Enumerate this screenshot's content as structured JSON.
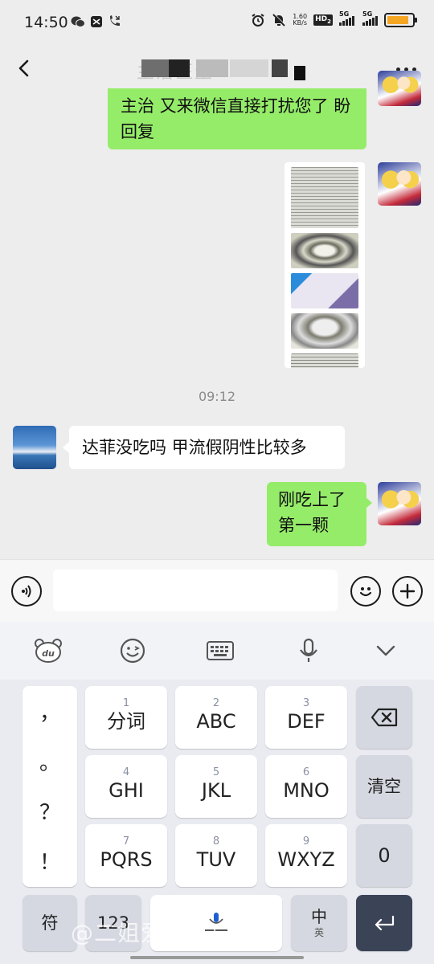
{
  "status_bar": {
    "time": "14:50",
    "net_speed": "1.60",
    "net_unit": "KB/s",
    "hd_badge": "HD",
    "hd_sub": "2",
    "sim1": "5G",
    "sim2": "5G",
    "battery_level": 0.85,
    "battery_color": "#f5a623",
    "icons": [
      "wechat-icon",
      "capcut-icon",
      "missed-call-icon",
      "alarm-icon",
      "mute-icon"
    ]
  },
  "header": {
    "title": "主治医生",
    "back_icon": "chevron-left-icon",
    "more_icon": "more-dots-icon"
  },
  "messages": {
    "m1": "主治   又来微信直接打扰您了 盼回复",
    "timestamp": "09:12",
    "m2": "达菲没吃吗 甲流假阴性比较多",
    "m3": "刚吃上了 第一颗"
  },
  "input_bar": {
    "voice_icon": "voice-icon",
    "emoji_icon": "emoji-icon",
    "plus_icon": "plus-icon"
  },
  "keyboard_toolbar": [
    "du-bear-icon",
    "smile-icon",
    "keyboard-icon",
    "mic-icon",
    "chevron-down-icon"
  ],
  "keyboard": {
    "symbols": [
      "，",
      "。",
      "？",
      "！"
    ],
    "keys": [
      {
        "num": "1",
        "label": "分词"
      },
      {
        "num": "2",
        "label": "ABC"
      },
      {
        "num": "3",
        "label": "DEF"
      },
      {
        "num": "4",
        "label": "GHI"
      },
      {
        "num": "5",
        "label": "JKL"
      },
      {
        "num": "6",
        "label": "MNO"
      },
      {
        "num": "7",
        "label": "PQRS"
      },
      {
        "num": "8",
        "label": "TUV"
      },
      {
        "num": "9",
        "label": "WXYZ"
      }
    ],
    "clear": "清空",
    "zero": "0",
    "fu": "符",
    "num123": "123",
    "zhong": "中",
    "ying": "英"
  },
  "watermark": "@二姐爱吃暖白小屋",
  "colors": {
    "mine_bubble": "#95ec69",
    "theirs_bubble": "#ffffff",
    "background": "#ededed",
    "keyboard_dark_key": "#3b4357"
  }
}
